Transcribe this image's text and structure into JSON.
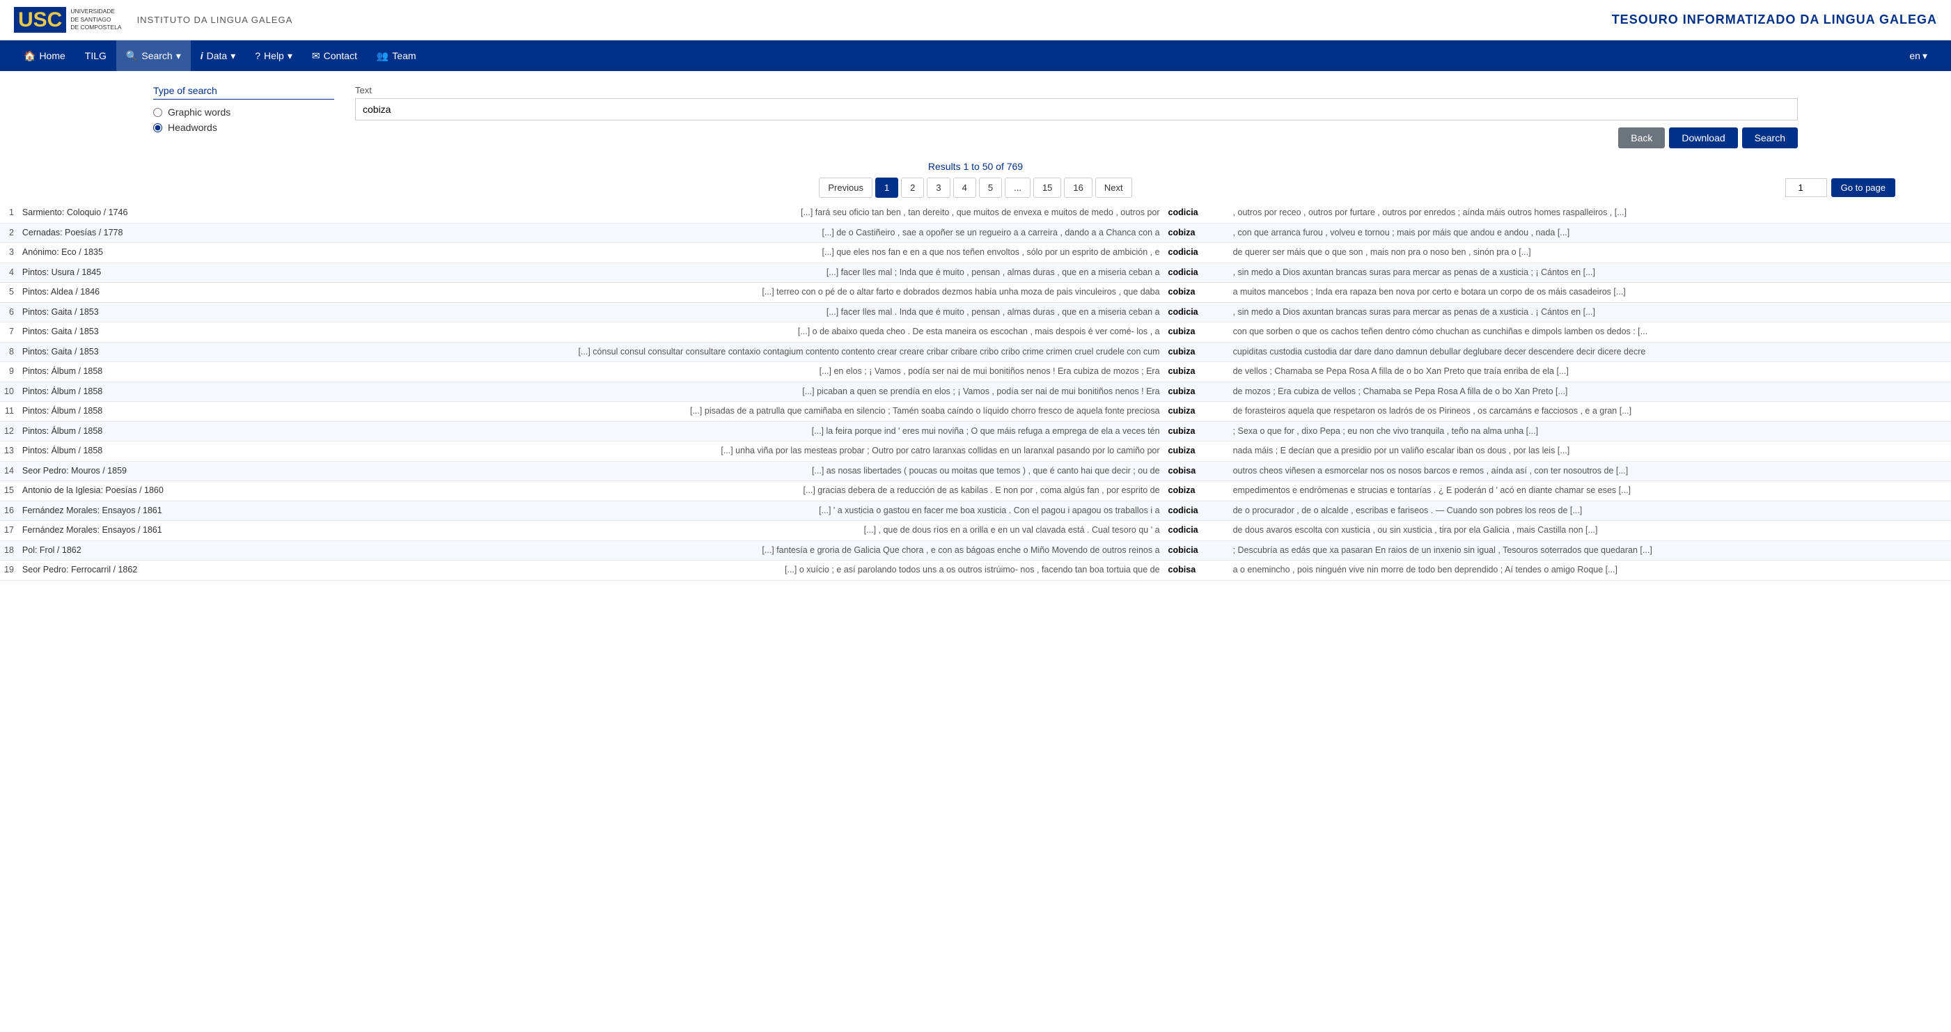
{
  "header": {
    "logo_text": "USC",
    "logo_sub": "UNIVERSIDADE\nDE SANTIAGO\nDE COMPOSTELA",
    "institution": "INSTITUTO DA LINGUA GALEGA",
    "title": "TESOURO INFORMATIZADO DA LINGUA GALEGA"
  },
  "nav": {
    "items": [
      {
        "id": "home",
        "label": "Home",
        "icon": "🏠",
        "active": false
      },
      {
        "id": "tilg",
        "label": "TILG",
        "icon": "",
        "active": false
      },
      {
        "id": "search",
        "label": "Search",
        "icon": "🔍",
        "active": true,
        "dropdown": true
      },
      {
        "id": "data",
        "label": "Data",
        "icon": "ℹ",
        "active": false,
        "dropdown": true
      },
      {
        "id": "help",
        "label": "Help",
        "icon": "?",
        "active": false,
        "dropdown": true
      },
      {
        "id": "contact",
        "label": "Contact",
        "icon": "✉",
        "active": false
      },
      {
        "id": "team",
        "label": "Team",
        "icon": "👥",
        "active": false
      }
    ],
    "lang": "en"
  },
  "search_form": {
    "type_label": "Type of search",
    "options": [
      {
        "id": "graphic",
        "label": "Graphic words",
        "selected": false
      },
      {
        "id": "headwords",
        "label": "Headwords",
        "selected": true
      }
    ],
    "text_label": "Text",
    "text_value": "cobiza",
    "text_placeholder": "",
    "buttons": {
      "back": "Back",
      "download": "Download",
      "search": "Search"
    }
  },
  "results": {
    "summary": "Results 1 to 50 of 769",
    "pagination": {
      "previous": "Previous",
      "next": "Next",
      "pages": [
        "1",
        "2",
        "3",
        "4",
        "5",
        "...",
        "15",
        "16"
      ],
      "active_page": "1",
      "go_label": "Go to page",
      "go_value": "1"
    },
    "rows": [
      {
        "num": "1",
        "source": "Sarmiento: Coloquio / 1746",
        "context": "[...] fará seu oficio tan ben , tan dereito , que muitos de envexa e muitos de medo , outros por",
        "word": "codicia",
        "after": ", outros por receo , outros por furtare , outros por enredos ; aínda máis outros homes raspalleiros , [...]"
      },
      {
        "num": "2",
        "source": "Cernadas: Poesías / 1778",
        "context": "[...] de o Castiñeiro , sae a opoñer se un regueiro a a carreira , dando a a Chanca con a",
        "word": "cobiza",
        "after": ", con que arranca furou , volveu e tornou ; mais por máis que andou e andou , nada [...]"
      },
      {
        "num": "3",
        "source": "Anónimo: Eco / 1835",
        "context": "[...] que eles nos fan e en a que nos teñen envoltos , sólo por un esprito de ambición , e",
        "word": "codicia",
        "after": "de querer ser máis que o que son , mais non pra o noso ben , sinón pra o [...]"
      },
      {
        "num": "4",
        "source": "Pintos: Usura / 1845",
        "context": "[...] facer lles mal ; Inda que é muito , pensan , almas duras , que en a miseria ceban a",
        "word": "codicia",
        "after": ", sin medo a Dios axuntan brancas suras para mercar as penas de a xusticia ; ¡ Cántos en [...]"
      },
      {
        "num": "5",
        "source": "Pintos: Aldea / 1846",
        "context": "[...] terreo con o pé de o altar farto e dobrados dezmos había unha moza de pais vinculeiros , que daba",
        "word": "cobiza",
        "after": "a muitos mancebos ; Inda era rapaza ben nova por certo e botara un corpo de os máis casadeiros [...]"
      },
      {
        "num": "6",
        "source": "Pintos: Gaita / 1853",
        "context": "[...] facer lles mal . Inda que é muito , pensan , almas duras , que en a miseria ceban a",
        "word": "codicia",
        "after": ", sin medo a Dios axuntan brancas suras para mercar as penas de a xusticia . ¡ Cántos en [...]"
      },
      {
        "num": "7",
        "source": "Pintos: Gaita / 1853",
        "context": "[...] o de abaixo queda cheo . De esta maneira os escochan , mais despois é ver comé- los , a",
        "word": "cubiza",
        "after": "con que sorben o que os cachos teñen dentro cómo chuchan as cunchiñas e dimpols lamben os dedos : [..."
      },
      {
        "num": "8",
        "source": "Pintos: Gaita / 1853",
        "context": "[...] cónsul consul consultar consultare contaxio contagium contento contento crear creare cribar cribare cribo cribo crime crimen cruel crudele con cum",
        "word": "cubiza",
        "after": "cupiditas custodia custodia dar dare dano damnun debullar deglubare decer descendere decir dicere decre"
      },
      {
        "num": "9",
        "source": "Pintos: Álbum / 1858",
        "context": "[...] en elos ; ¡ Vamos , podía ser nai de mui bonitiños nenos ! Era cubiza de mozos ; Era",
        "word": "cubiza",
        "after": "de vellos ; Chamaba se Pepa Rosa A filla de o bo Xan Preto que traía enriba de ela [...]"
      },
      {
        "num": "10",
        "source": "Pintos: Álbum / 1858",
        "context": "[...] picaban a quen se prendía en elos ; ¡ Vamos , podía ser nai de mui bonitiños nenos ! Era",
        "word": "cubiza",
        "after": "de mozos ; Era cubiza de vellos ; Chamaba se Pepa Rosa A filla de o bo Xan Preto [...]"
      },
      {
        "num": "11",
        "source": "Pintos: Álbum / 1858",
        "context": "[...] pisadas de a patrulla que camiñaba en silencio ; Tamén soaba caíndo o líquido chorro fresco de aquela fonte preciosa",
        "word": "cubiza",
        "after": "de forasteiros aquela que respetaron os ladrós de os Pirineos , os carcamáns e facciosos , e a gran [...]"
      },
      {
        "num": "12",
        "source": "Pintos: Álbum / 1858",
        "context": "[...] la feira porque ind ' eres mui noviña ; O que máis refuga a emprega de ela a veces tén",
        "word": "cubiza",
        "after": "; Sexa o que for , dixo Pepa ; eu non che vivo tranquila , teño na alma unha [...]"
      },
      {
        "num": "13",
        "source": "Pintos: Álbum / 1858",
        "context": "[...] unha viña por las mesteas probar ; Outro por catro laranxas collidas en un laranxal pasando por lo camiño por",
        "word": "cubiza",
        "after": "nada máis ; E decían que a presidio por un valiño escalar iban os dous , por las leis [...]"
      },
      {
        "num": "14",
        "source": "Seor Pedro: Mouros / 1859",
        "context": "[...] as nosas libertades ( poucas ou moitas que temos ) , que é canto hai que decir ; ou de",
        "word": "cobisa",
        "after": "outros cheos viñesen a esmorcelar nos os nosos barcos e remos , aínda así , con ter nosoutros de [...]"
      },
      {
        "num": "15",
        "source": "Antonio de la Iglesia: Poesías / 1860",
        "context": "[...] gracias debera de a reducción de as kabilas . E non por , coma algús fan , por esprito de",
        "word": "cobiza",
        "after": "empedimentos e endrómenas e strucias e tontarías . ¿ E poderán d ' acó en diante chamar se eses [...]"
      },
      {
        "num": "16",
        "source": "Fernández Morales: Ensayos / 1861",
        "context": "[...] ' a xusticia o gastou en facer me boa xusticia . Con el pagou i apagou os traballos i a",
        "word": "codicia",
        "after": "de o procurador , de o alcalde , escribas e fariseos . — Cuando son pobres los reos de [...]"
      },
      {
        "num": "17",
        "source": "Fernández Morales: Ensayos / 1861",
        "context": "[...] , que de dous ríos en a orilla e en un val clavada está . Cual tesoro qu ' a",
        "word": "codicia",
        "after": "de dous avaros escolta con xusticia , ou sin xusticia , tira por ela Galicia , mais Castilla non [...]"
      },
      {
        "num": "18",
        "source": "Pol: Frol / 1862",
        "context": "[...] fantesía e groria de Galicia Que chora , e con as bágoas enche o Miño Movendo de outros reinos a",
        "word": "cobicia",
        "after": "; Descubría as edás que xa pasaran En raios de un inxenio sin igual , Tesouros soterrados que quedaran [...]"
      },
      {
        "num": "19",
        "source": "Seor Pedro: Ferrocarril / 1862",
        "context": "[...] o xuício ; e así parolando todos uns a os outros istrúimo- nos , facendo tan boa tortuia que de",
        "word": "cobisa",
        "after": "a o enemincho , pois ninguén vive nin morre de todo ben deprendido ; Aí tendes o amigo Roque [...]"
      }
    ]
  }
}
